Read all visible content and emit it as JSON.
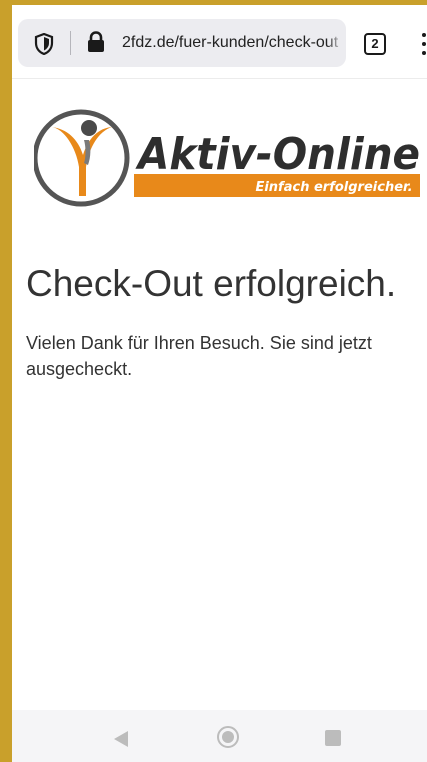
{
  "browser": {
    "url": "2fdz.de/fuer-kunden/check-out",
    "tab_count": "2",
    "icons": [
      "shield-icon",
      "lock-icon",
      "tabs-icon",
      "menu-icon"
    ]
  },
  "logo": {
    "title": "Aktiv-Online",
    "tagline": "Einfach erfolgreicher.",
    "colors": {
      "orange": "#e8891a",
      "gray": "#555555",
      "title": "#2e2e2e"
    }
  },
  "page": {
    "heading": "Check-Out erfolgreich.",
    "message": "Vielen Dank für Ihren Besuch. Sie sind jetzt ausgecheckt."
  },
  "android_nav": {
    "icons": [
      "back-icon",
      "home-icon",
      "recents-icon"
    ]
  },
  "colors": {
    "frame": "#c9a02b",
    "text": "#333333",
    "urlbar": "#ececf0"
  }
}
